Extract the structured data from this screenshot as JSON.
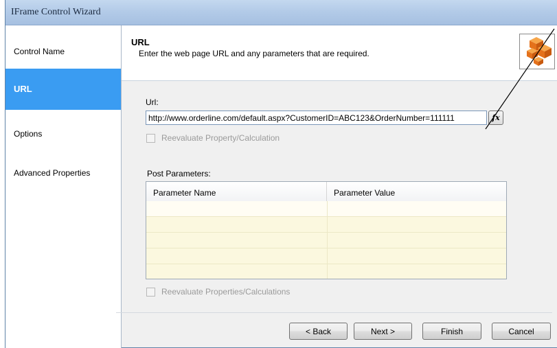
{
  "window": {
    "title": "IFrame Control Wizard"
  },
  "sidebar": {
    "items": [
      {
        "label": "Control Name",
        "active": false
      },
      {
        "label": "URL",
        "active": true
      },
      {
        "label": "Options",
        "active": false
      },
      {
        "label": "Advanced Properties",
        "active": false
      }
    ]
  },
  "header": {
    "title": "URL",
    "subtitle": "Enter the web page URL and any parameters that are required."
  },
  "url_section": {
    "label": "Url:",
    "value": "http://www.orderline.com/default.aspx?CustomerID=ABC123&OrderNumber=111111",
    "fx_label": "fx",
    "reevaluate_label": "Reevaluate Property/Calculation",
    "reevaluate_checked": false
  },
  "post_parameters": {
    "label": "Post Parameters:",
    "columns": [
      "Parameter Name",
      "Parameter Value"
    ],
    "rows": [
      [
        "",
        ""
      ],
      [
        "",
        ""
      ],
      [
        "",
        ""
      ],
      [
        "",
        ""
      ],
      [
        "",
        ""
      ]
    ],
    "reevaluate_label": "Reevaluate Properties/Calculations",
    "reevaluate_checked": false
  },
  "buttons": {
    "back": "< Back",
    "next": "Next >",
    "finish": "Finish",
    "cancel": "Cancel"
  },
  "icons": [
    "wizard-cube-logo-icon",
    "fx-icon"
  ],
  "colors": {
    "active_sidebar": "#3a9cf2",
    "grid_background": "#fbf8df"
  }
}
